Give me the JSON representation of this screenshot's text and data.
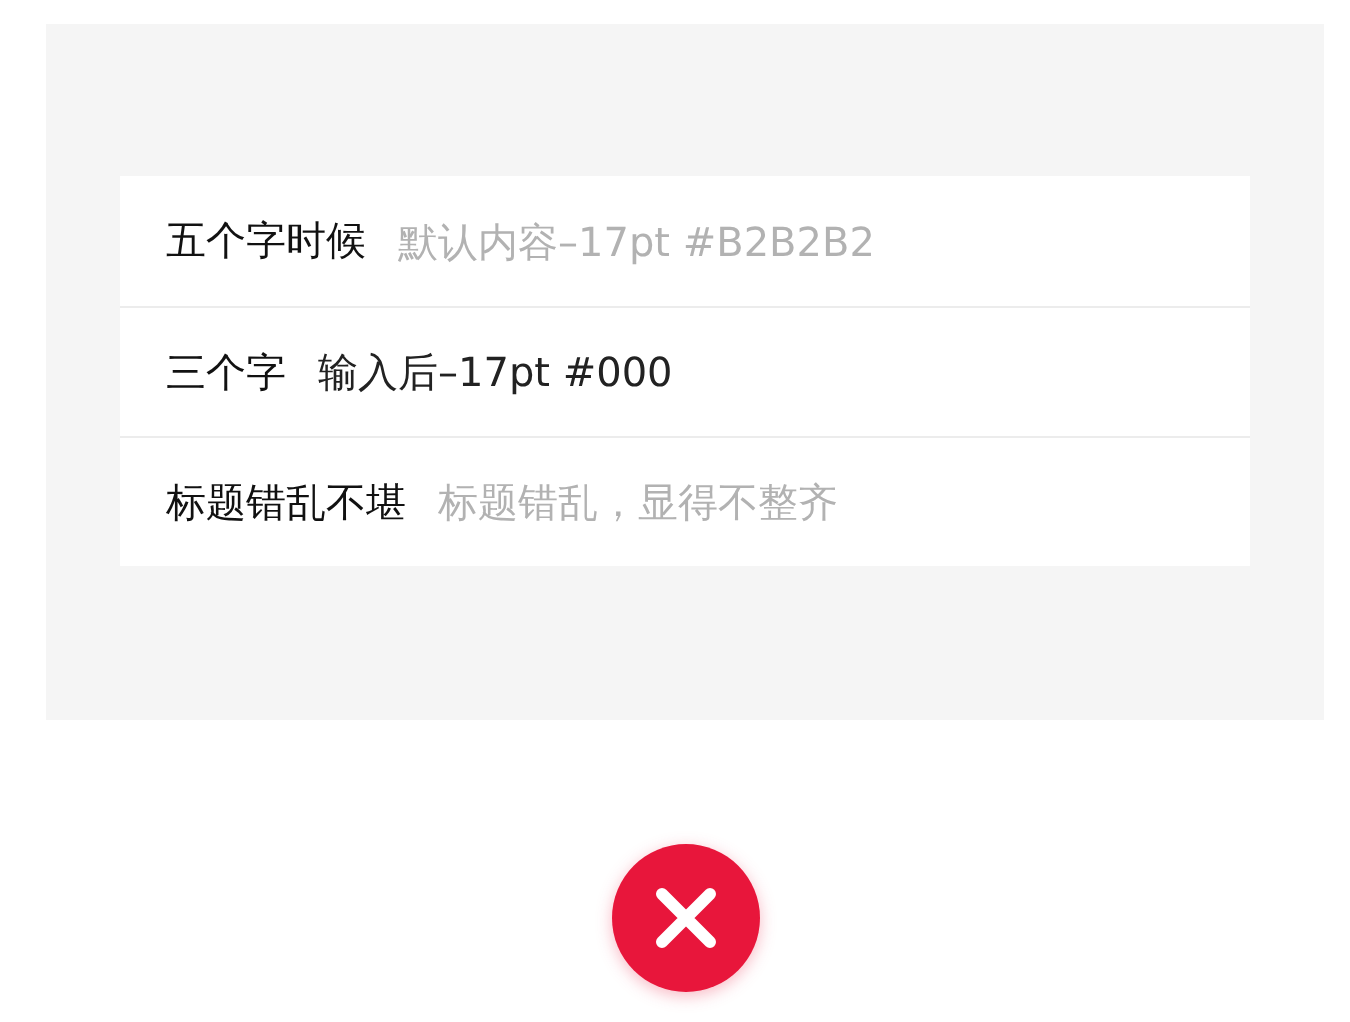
{
  "form": {
    "rows": [
      {
        "label": "五个字时候",
        "placeholder": "默认内容–17pt #B2B2B2"
      },
      {
        "label": "三个字",
        "value": "输入后–17pt #000"
      },
      {
        "label": "标题错乱不堪",
        "placeholder": "标题错乱，显得不整齐"
      }
    ]
  },
  "verdict": {
    "kind": "wrong"
  }
}
